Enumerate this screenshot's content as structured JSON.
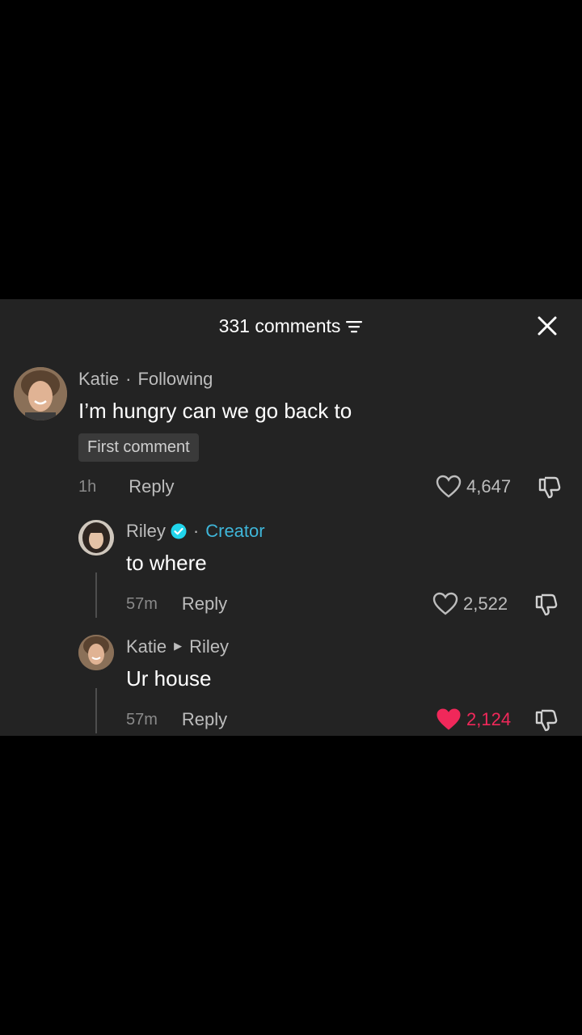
{
  "header": {
    "count_label": "331 comments"
  },
  "colors": {
    "panel": "#232323",
    "creator": "#3fb6d9",
    "liked": "#f0285a"
  },
  "comments": [
    {
      "author": "Katie",
      "relation": "Following",
      "text": "I’m hungry can we go back to",
      "badge": "First comment",
      "time": "1h",
      "reply_label": "Reply",
      "likes": "4,647"
    },
    {
      "author": "Riley",
      "relation": "Creator",
      "text": "to where",
      "time": "57m",
      "reply_label": "Reply",
      "likes": "2,522"
    },
    {
      "author": "Katie",
      "reply_to": "Riley",
      "text": "Ur house",
      "time": "57m",
      "reply_label": "Reply",
      "likes": "2,124",
      "liked": true
    }
  ]
}
